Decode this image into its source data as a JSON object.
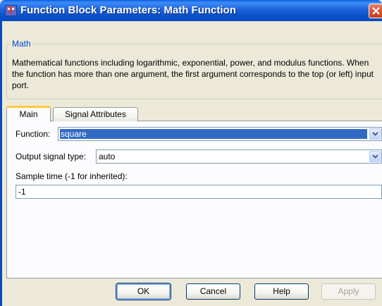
{
  "window": {
    "title": "Function Block Parameters: Math Function",
    "icon": "simulink-block-icon",
    "close_icon": "close-icon"
  },
  "group": {
    "legend": "Math",
    "description": "Mathematical functions including logarithmic, exponential, power, and modulus functions.  When the function has more than one argument, the first argument corresponds to the top (or left) input port."
  },
  "tabs": [
    {
      "label": "Main",
      "active": true
    },
    {
      "label": "Signal Attributes",
      "active": false
    }
  ],
  "main": {
    "function_label": "Function:",
    "function_value": "square",
    "output_type_label": "Output signal type:",
    "output_type_value": "auto",
    "sample_time_label": "Sample time (-1 for inherited):",
    "sample_time_value": "-1"
  },
  "buttons": {
    "ok": "OK",
    "cancel": "Cancel",
    "help": "Help",
    "apply": "Apply"
  },
  "colors": {
    "titlebar": "#0a50c8",
    "selection": "#316ac5",
    "legend_text": "#0046d5",
    "dialog_bg": "#ece9d8",
    "close_button": "#d9533a"
  }
}
